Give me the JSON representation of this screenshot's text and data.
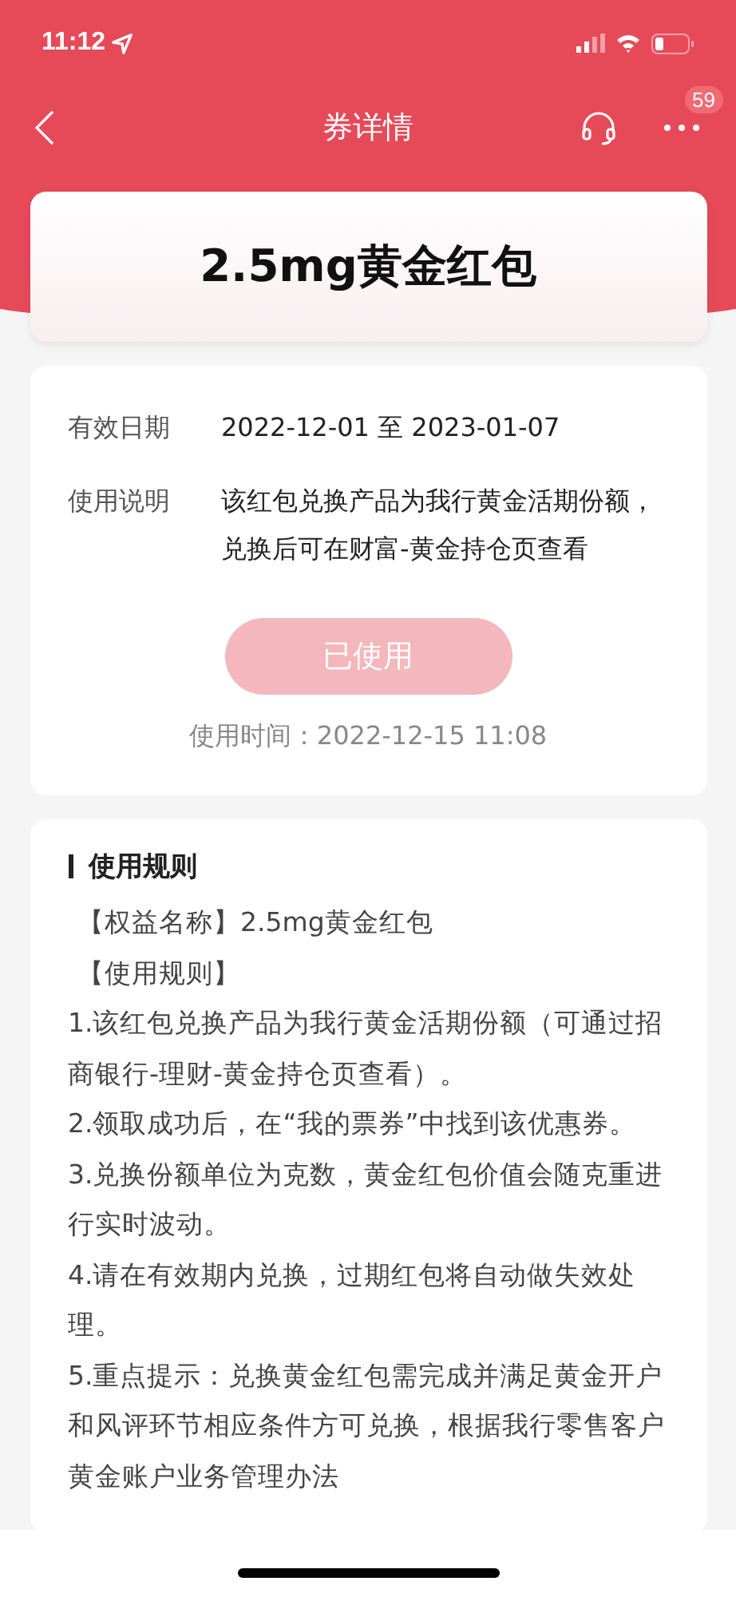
{
  "status_bar": {
    "time": "11:12"
  },
  "nav": {
    "title": "券详情",
    "badge": "59"
  },
  "coupon": {
    "title": "2.5mg黄金红包"
  },
  "details": [
    {
      "label": "有效日期",
      "value": "2022-12-01 至 2023-01-07"
    },
    {
      "label": "使用说明",
      "value": "该红包兑换产品为我行黄金活期份额，兑换后可在财富-黄金持仓页查看"
    }
  ],
  "action": {
    "label": "已使用",
    "disabled": true
  },
  "used_time": "使用时间：2022-12-15 11:08",
  "rules": {
    "heading": "使用规则",
    "lines": [
      "【权益名称】2.5mg黄金红包",
      "【使用规则】",
      "1.该红包兑换产品为我行黄金活期份额（可通过招商银行-理财-黄金持仓页查看）。",
      "2.领取成功后，在“我的票券”中找到该优惠券。",
      "3.兑换份额单位为克数，黄金红包价值会随克重进行实时波动。",
      "4.请在有效期内兑换，过期红包将自动做失效处理。",
      "5.重点提示：兑换黄金红包需完成并满足黄金开户和风评环节相应条件方可兑换，根据我行零售客户黄金账户业务管理办法"
    ]
  }
}
